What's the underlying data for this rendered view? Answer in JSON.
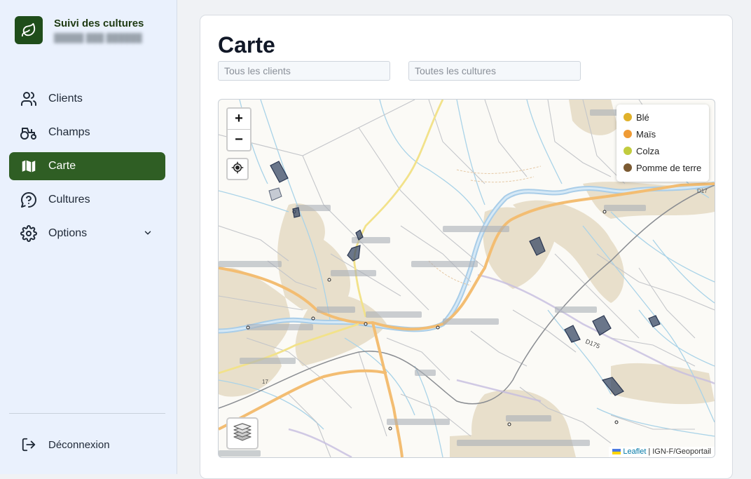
{
  "app": {
    "title": "Suivi des cultures",
    "subtitle": "█████ ███ ██████"
  },
  "nav": {
    "items": [
      {
        "label": "Clients",
        "icon": "users-icon"
      },
      {
        "label": "Champs",
        "icon": "tractor-icon"
      },
      {
        "label": "Carte",
        "icon": "map-icon",
        "active": true
      },
      {
        "label": "Cultures",
        "icon": "plant-question-icon"
      },
      {
        "label": "Options",
        "icon": "gear-icon",
        "expandable": true
      }
    ],
    "logout_label": "Déconnexion"
  },
  "page": {
    "title": "Carte",
    "filter_clients_placeholder": "Tous les clients",
    "filter_cultures_placeholder": "Toutes les cultures"
  },
  "map": {
    "zoom_in": "+",
    "zoom_out": "−",
    "legend": [
      {
        "label": "Blé",
        "color": "#e0b12a"
      },
      {
        "label": "Maïs",
        "color": "#ef9b35"
      },
      {
        "label": "Colza",
        "color": "#c2cc3f"
      },
      {
        "label": "Pomme de terre",
        "color": "#7b5a32"
      }
    ],
    "attribution": {
      "leaflet": "Leaflet",
      "separator": "|",
      "provider": "IGN-F/Geoportail"
    },
    "road_labels": [
      "D175",
      "17",
      "D17"
    ]
  },
  "colors": {
    "accent": "#2f5e24",
    "brand_dark": "#1f4d1a",
    "sidebar_bg": "#eaf1fd",
    "field_fill": "#3a4a66"
  }
}
